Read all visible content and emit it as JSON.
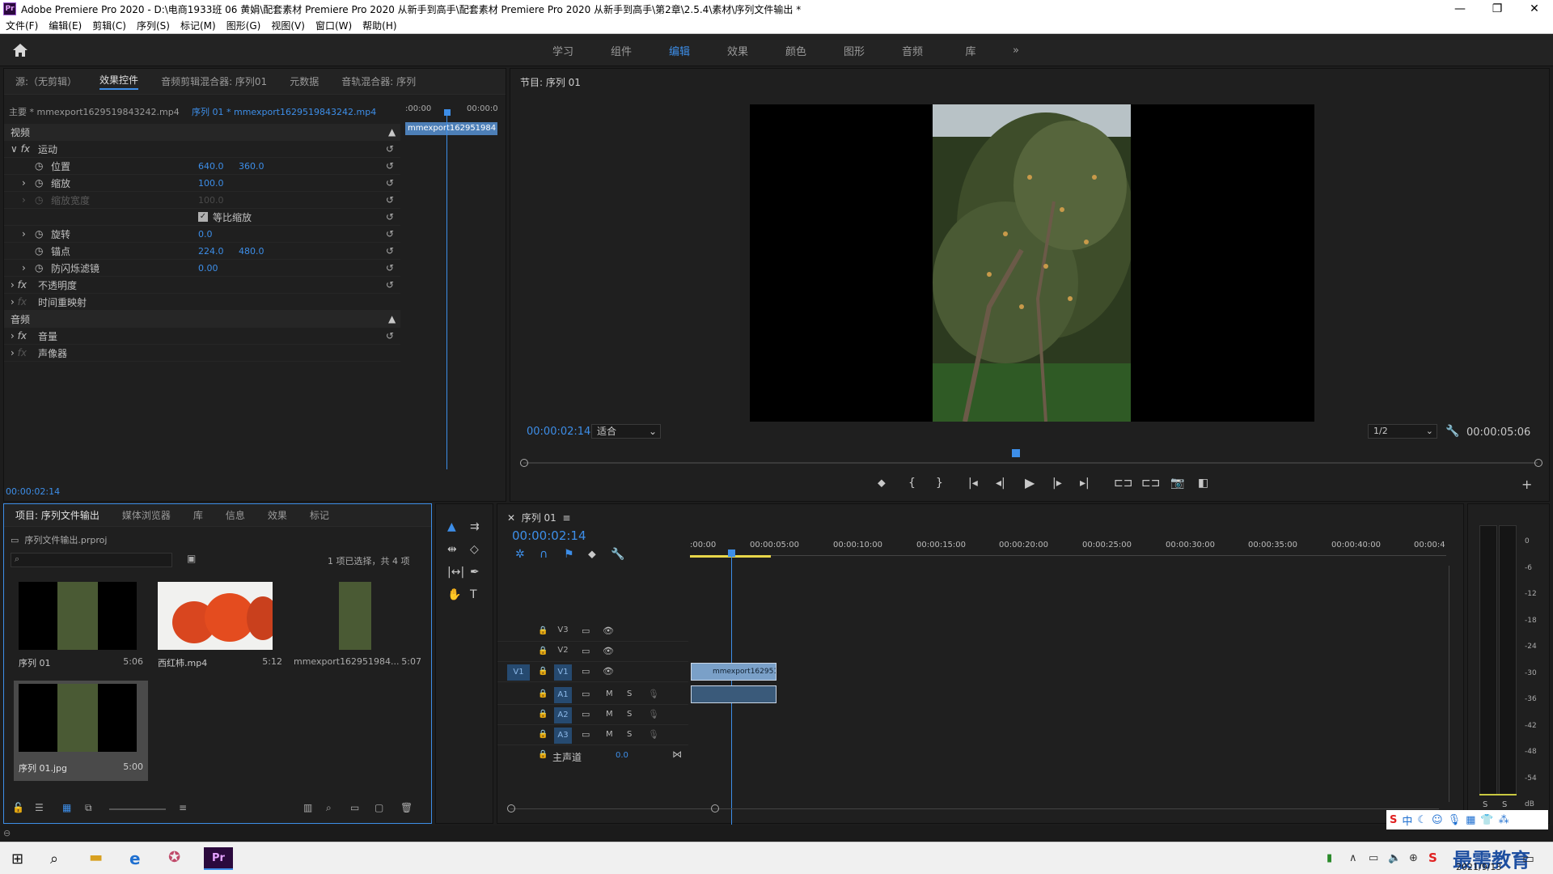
{
  "titlebar": {
    "app_icon": "Pr",
    "title": "Adobe Premiere Pro 2020 - D:\\电商1933班  06  黄娟\\配套素材 Premiere Pro 2020 从新手到高手\\配套素材 Premiere Pro 2020 从新手到高手\\第2章\\2.5.4\\素材\\序列文件输出 *",
    "minimize": "—",
    "maximize": "❐",
    "close": "✕"
  },
  "menu": [
    "文件(F)",
    "编辑(E)",
    "剪辑(C)",
    "序列(S)",
    "标记(M)",
    "图形(G)",
    "视图(V)",
    "窗口(W)",
    "帮助(H)"
  ],
  "workspaces": {
    "tabs": [
      "学习",
      "组件",
      "编辑",
      "效果",
      "颜色",
      "图形",
      "音频",
      "库"
    ],
    "active": "编辑",
    "more": "»"
  },
  "effect_panel": {
    "tabs": [
      "源:（无剪辑）",
      "效果控件",
      "音频剪辑混合器: 序列01",
      "元数据",
      "音轨混合器: 序列"
    ],
    "master_clip": "主要 * mmexport1629519843242.mp4",
    "seq_clip": "序列 01 * mmexport1629519843242.mp4",
    "ruler_start": ":00:00",
    "ruler_end": "00:00:0",
    "clip_label": "mmexport162951984",
    "video_section": "视频",
    "motion": "运动",
    "position_label": "位置",
    "position_x": "640.0",
    "position_y": "360.0",
    "scale_label": "缩放",
    "scale_value": "100.0",
    "scale_width_label": "缩放宽度",
    "scale_width_value": "100.0",
    "uniform_scale": "等比缩放",
    "rotation_label": "旋转",
    "rotation_value": "0.0",
    "anchor_label": "锚点",
    "anchor_x": "224.0",
    "anchor_y": "480.0",
    "flicker_label": "防闪烁滤镜",
    "flicker_value": "0.00",
    "opacity": "不透明度",
    "time_remap": "时间重映射",
    "audio_section": "音频",
    "volume": "音量",
    "panner": "声像器",
    "timecode": "00:00:02:14"
  },
  "program_monitor": {
    "title": "节目: 序列 01",
    "timecode": "00:00:02:14",
    "fit": "适合",
    "resolution": "1/2",
    "duration": "00:00:05:06"
  },
  "project_panel": {
    "tabs": [
      "项目: 序列文件输出",
      "媒体浏览器",
      "库",
      "信息",
      "效果",
      "标记"
    ],
    "project_file": "序列文件输出.prproj",
    "selection_info": "1 项已选择，共 4 项",
    "items": [
      {
        "name": "序列 01",
        "duration": "5:06"
      },
      {
        "name": "西红柿.mp4",
        "duration": "5:12"
      },
      {
        "name": "mmexport162951984...",
        "duration": "5:07"
      },
      {
        "name": "序列 01.jpg",
        "duration": "5:00"
      }
    ]
  },
  "timeline": {
    "tab": "序列 01",
    "timecode": "00:00:02:14",
    "ruler": [
      ":00:00",
      "00:00:05:00",
      "00:00:10:00",
      "00:00:15:00",
      "00:00:20:00",
      "00:00:25:00",
      "00:00:30:00",
      "00:00:35:00",
      "00:00:40:00",
      "00:00:4"
    ],
    "video_tracks": [
      "V3",
      "V2",
      "V1"
    ],
    "audio_tracks": [
      "A1",
      "A2",
      "A3"
    ],
    "source_patch": "V1",
    "mute": "M",
    "solo": "S",
    "master_label": "主声道",
    "master_value": "0.0",
    "clip_name": "mmexport162951"
  },
  "meter": {
    "scale": [
      "0",
      "-6",
      "-12",
      "-18",
      "-24",
      "-30",
      "-36",
      "-42",
      "-48",
      "-54",
      "dB"
    ],
    "solo_left": "S",
    "solo_right": "S"
  },
  "taskbar": {
    "date": "2021/9/13",
    "watermark": "最需教育",
    "ime": "中"
  },
  "colors": {
    "accent": "#3d8ee8",
    "panel": "#1f1f1f",
    "clip_video": "#7aa0c8",
    "clip_audio": "#3a5a7a"
  }
}
